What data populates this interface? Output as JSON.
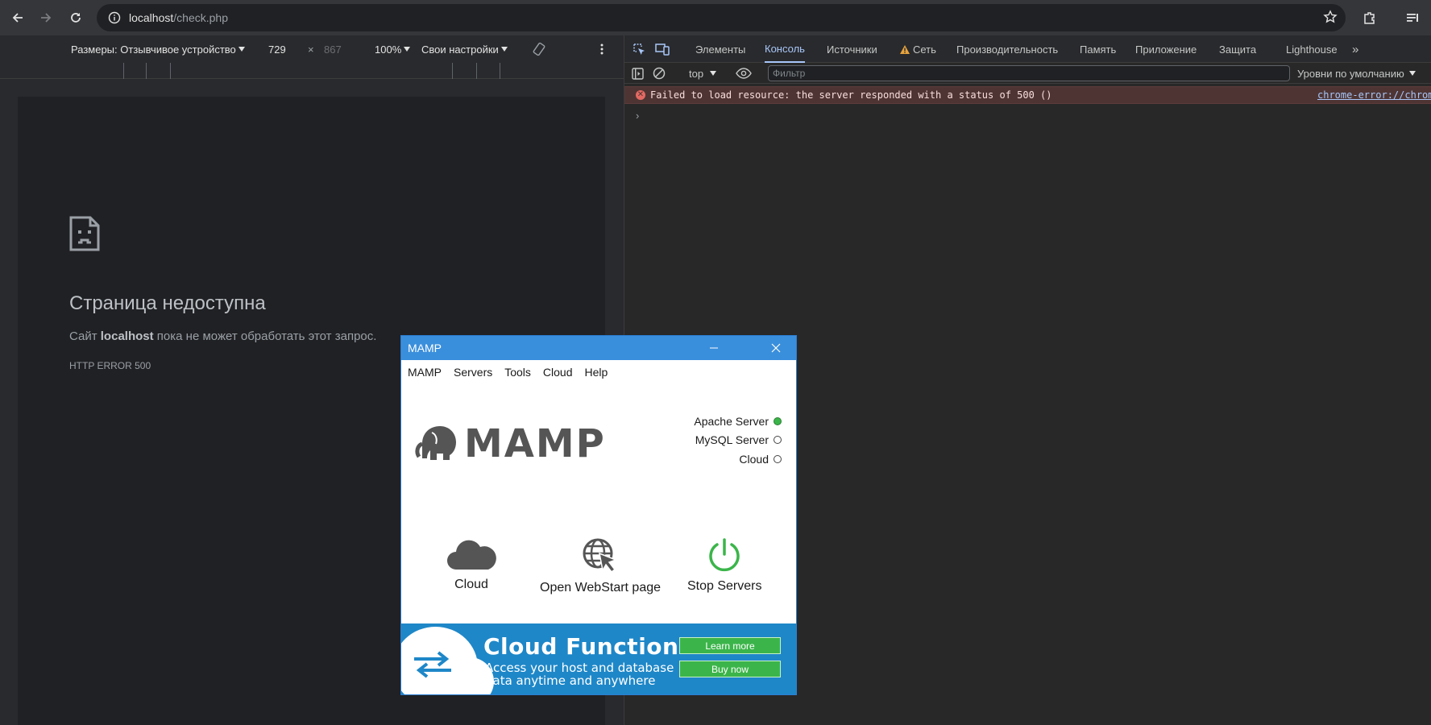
{
  "browser": {
    "address_host": "localhost",
    "address_path": "/check.php"
  },
  "device_toolbar": {
    "dimensions_label": "Размеры: Отзывчивое устройство",
    "width": "729",
    "times": "×",
    "height": "867",
    "zoom": "100%",
    "throttle": "Свои настройки"
  },
  "error_page": {
    "title": "Страница недоступна",
    "desc_prefix": "Сайт ",
    "desc_host": "localhost",
    "desc_suffix": " пока не может обработать этот запрос.",
    "code": "HTTP ERROR 500"
  },
  "devtools": {
    "tabs": [
      "Элементы",
      "Консоль",
      "Источники",
      "Сеть",
      "Производительность",
      "Память",
      "Приложение",
      "Защита",
      "Lighthouse"
    ],
    "active_tab": "Консоль",
    "context": "top",
    "filter_placeholder": "Фильтр",
    "levels": "Уровни по умолчанию",
    "error_message": "Failed to load resource: the server responded with a status of 500 ()",
    "error_source": "chrome-error://chromewebdata/",
    "prompt": "›"
  },
  "mamp": {
    "title": "MAMP",
    "menu": [
      "MAMP",
      "Servers",
      "Tools",
      "Cloud",
      "Help"
    ],
    "logo_text": "MAMP",
    "servers": [
      {
        "label": "Apache Server",
        "running": true
      },
      {
        "label": "MySQL Server",
        "running": false
      },
      {
        "label": "Cloud",
        "running": false
      }
    ],
    "actions": {
      "cloud": "Cloud",
      "webstart": "Open WebStart page",
      "stop": "Stop Servers"
    },
    "banner": {
      "heading": "Cloud Function",
      "sub_line1": "Access your host and database",
      "sub_line2": "data anytime and anywhere",
      "learn_more": "Learn more",
      "buy_now": "Buy now"
    },
    "colors": {
      "title_bar": "#3a8fdc",
      "banner": "#1e87c8",
      "green": "#3bb54a"
    }
  }
}
